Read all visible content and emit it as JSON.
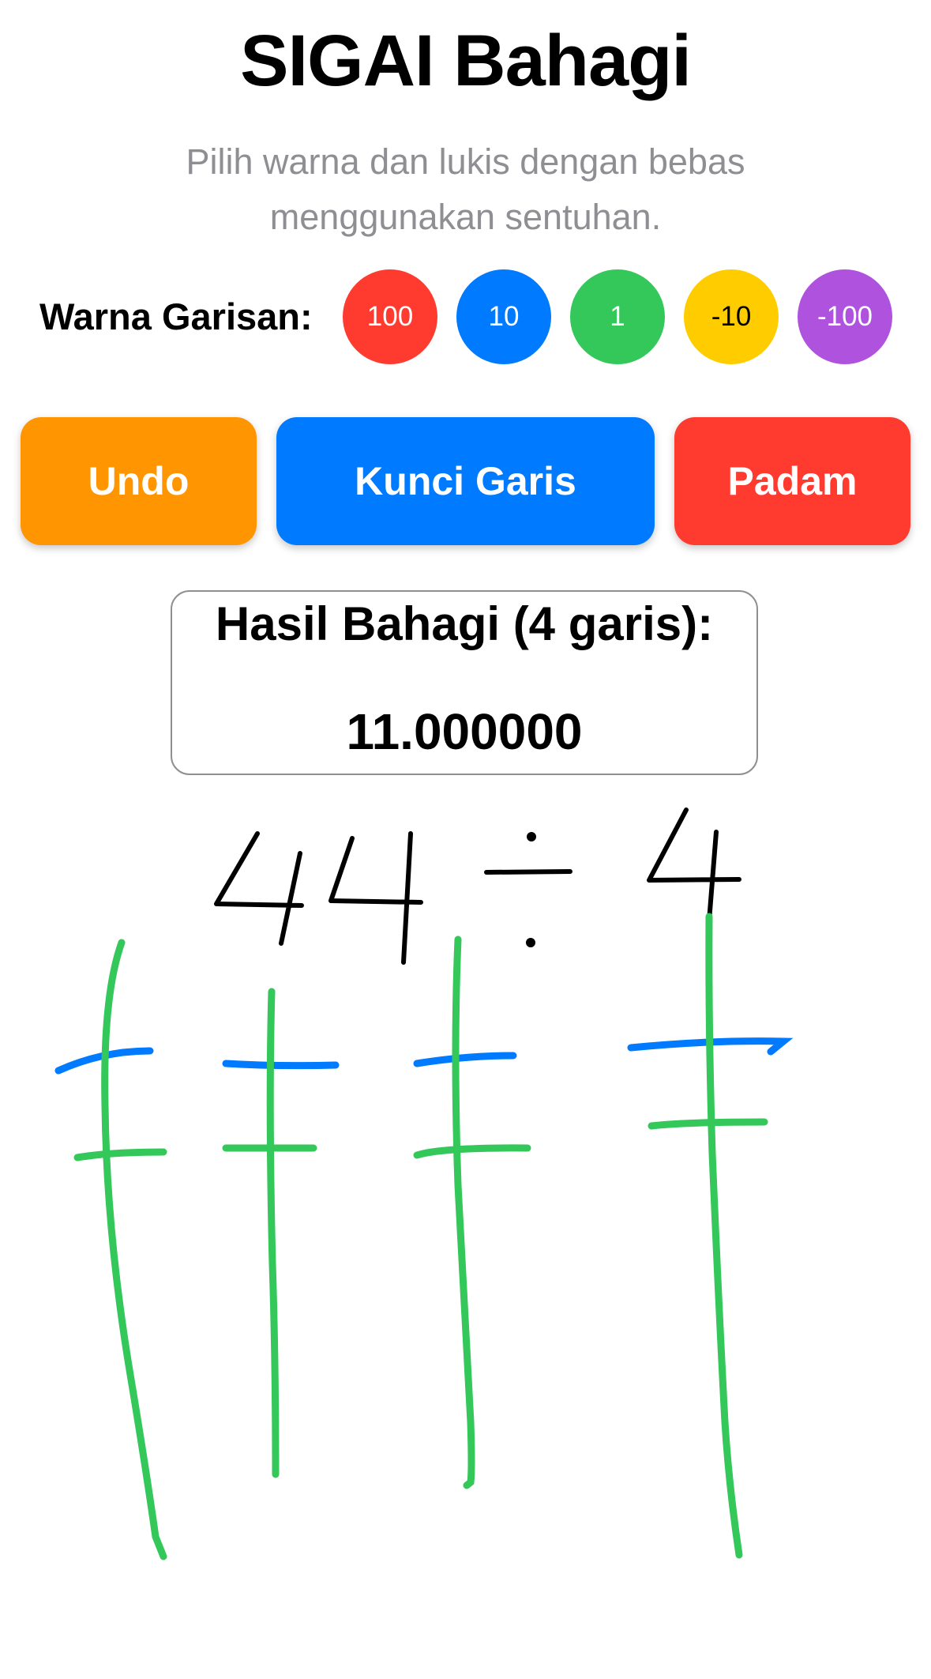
{
  "header": {
    "title": "SIGAI Bahagi",
    "subtitle": "Pilih warna dan lukis dengan bebas menggunakan sentuhan."
  },
  "color_picker": {
    "label": "Warna Garisan:",
    "swatches": [
      {
        "label": "100",
        "color": "#ff3b30",
        "text_color": "#ffffff"
      },
      {
        "label": "10",
        "color": "#007aff",
        "text_color": "#ffffff"
      },
      {
        "label": "1",
        "color": "#34c759",
        "text_color": "#ffffff"
      },
      {
        "label": "-10",
        "color": "#ffcc00",
        "text_color": "#000000"
      },
      {
        "label": "-100",
        "color": "#af52de",
        "text_color": "#ffffff"
      }
    ]
  },
  "actions": {
    "undo_label": "Undo",
    "undo_color": "#ff9500",
    "lock_label": "Kunci Garis",
    "lock_color": "#007aff",
    "clear_label": "Padam",
    "clear_color": "#ff3b30"
  },
  "result": {
    "heading": "Hasil Bahagi (4 garis):",
    "value": "11.000000"
  },
  "canvas": {
    "ink_color": "#000000",
    "handwriting_note": "44 ÷ 4 (handwritten)",
    "stroke_colors": {
      "tens": "#007aff",
      "ones": "#34c759"
    }
  }
}
